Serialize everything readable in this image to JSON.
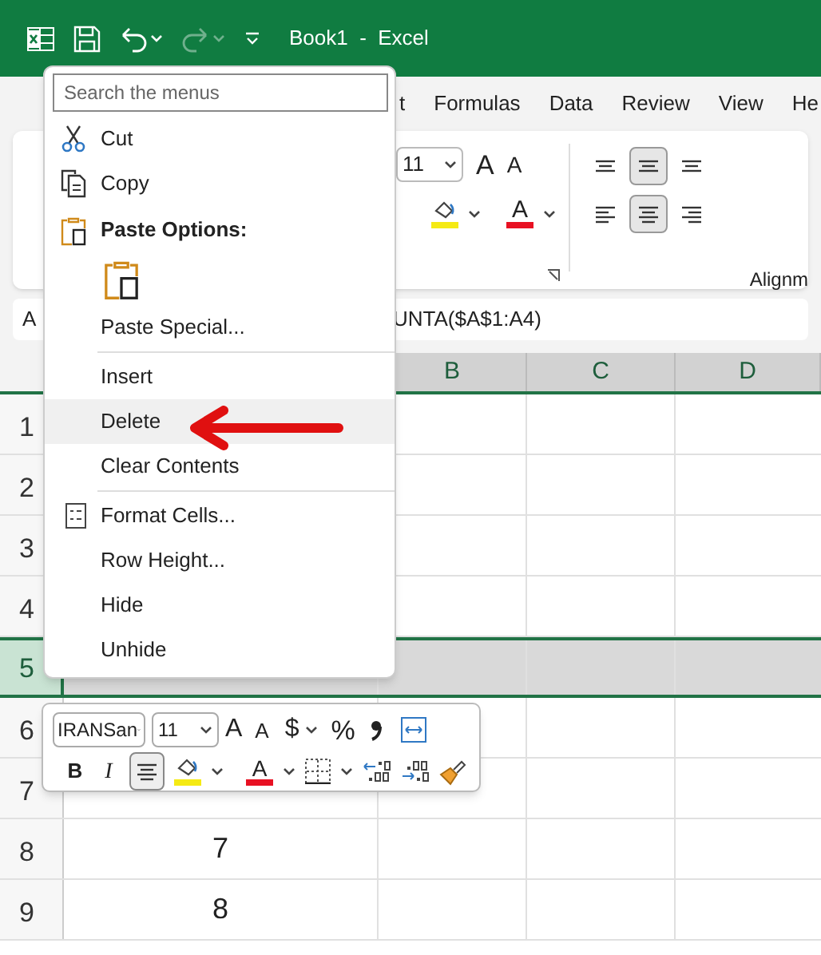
{
  "title_bar": {
    "title": "Book1  -  Excel"
  },
  "ribbon_tabs": [
    {
      "label": "t",
      "selected": false
    },
    {
      "label": "Formulas",
      "selected": false
    },
    {
      "label": "Data",
      "selected": false
    },
    {
      "label": "Review",
      "selected": false
    },
    {
      "label": "View",
      "selected": false
    },
    {
      "label": "He",
      "selected": false
    }
  ],
  "ribbon": {
    "font_size": "11",
    "grow_font": "A",
    "shrink_font": "A",
    "font_color": "A",
    "group_label": "Alignm",
    "alignment_buttons": [
      {
        "pressed": false
      },
      {
        "pressed": true
      },
      {
        "pressed": false
      },
      {
        "pressed": false
      },
      {
        "pressed": true
      },
      {
        "pressed": false
      }
    ]
  },
  "formula_bar": {
    "name_box": "A",
    "formula": "UNTA($A$1:A4)"
  },
  "columns": [
    "B",
    "C",
    "D"
  ],
  "rows": [
    {
      "header": "1",
      "selected": false
    },
    {
      "header": "2",
      "selected": false
    },
    {
      "header": "3",
      "selected": false
    },
    {
      "header": "4",
      "selected": false
    },
    {
      "header": "5",
      "selected": true
    },
    {
      "header": "6",
      "selected": false
    },
    {
      "header": "7",
      "selected": false
    },
    {
      "header": "8",
      "cell_a": "7",
      "selected": false
    },
    {
      "header": "9",
      "cell_a": "8",
      "selected": false
    }
  ],
  "context_menu": {
    "search": {
      "placeholder": "Search the menus"
    },
    "items": [
      {
        "kind": "item",
        "label": "Cut",
        "selected": false
      },
      {
        "kind": "item",
        "label": "Copy",
        "selected": false
      },
      {
        "kind": "heading",
        "label": "Paste Options:"
      },
      {
        "kind": "paste"
      },
      {
        "kind": "item",
        "label": "Paste Special...",
        "selected": false
      },
      {
        "kind": "item",
        "label": "Insert",
        "separator_before": true,
        "selected": false
      },
      {
        "kind": "item",
        "label": "Delete",
        "selected": true
      },
      {
        "kind": "item",
        "label": "Clear Contents",
        "selected": false
      },
      {
        "kind": "item",
        "label": "Format Cells...",
        "separator_before": true,
        "selected": false
      },
      {
        "kind": "item",
        "label": "Row Height...",
        "selected": false
      },
      {
        "kind": "item",
        "label": "Hide",
        "selected": false
      },
      {
        "kind": "item",
        "label": "Unhide",
        "selected": false
      }
    ]
  },
  "mini_toolbar": {
    "font": "IRANSan",
    "size": "11",
    "grow_font": "A",
    "shrink_font": "A",
    "currency": "$",
    "percent": "%",
    "bold": "B",
    "italic": "I",
    "font_color": "A",
    "center_pressed": true
  }
}
